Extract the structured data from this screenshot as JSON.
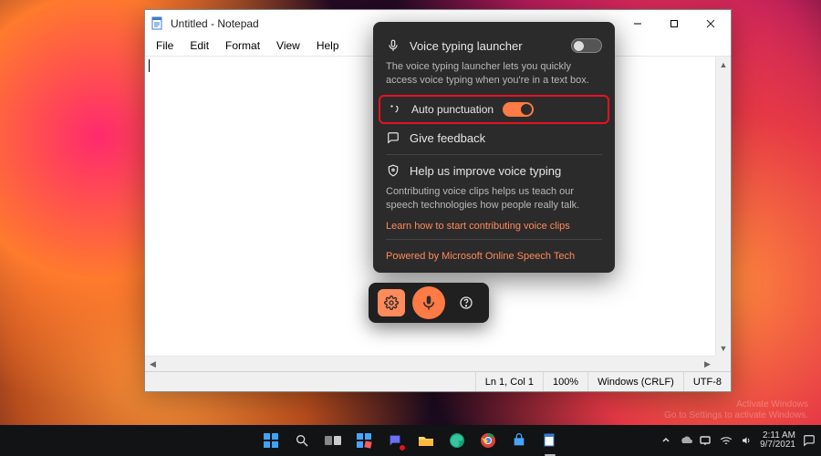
{
  "notepad": {
    "title": "Untitled - Notepad",
    "menu": {
      "file": "File",
      "edit": "Edit",
      "format": "Format",
      "view": "View",
      "help": "Help"
    },
    "status": {
      "pos": "Ln 1, Col 1",
      "zoom": "100%",
      "eol": "Windows (CRLF)",
      "encoding": "UTF-8"
    }
  },
  "voice_typing": {
    "launcher_label": "Voice typing launcher",
    "launcher_desc": "The voice typing launcher lets you quickly access voice typing when you're in a text box.",
    "auto_punct_label": "Auto punctuation",
    "feedback_label": "Give feedback",
    "improve_label": "Help us improve voice typing",
    "improve_desc": "Contributing voice clips helps us teach our speech technologies how people really talk.",
    "learn_link": "Learn how to start contributing voice clips",
    "powered": "Powered by Microsoft Online Speech Tech"
  },
  "watermark": {
    "line1": "Activate Windows",
    "line2": "Go to Settings to activate Windows."
  },
  "tray": {
    "time": "2:11 AM",
    "date": "9/7/2021"
  }
}
